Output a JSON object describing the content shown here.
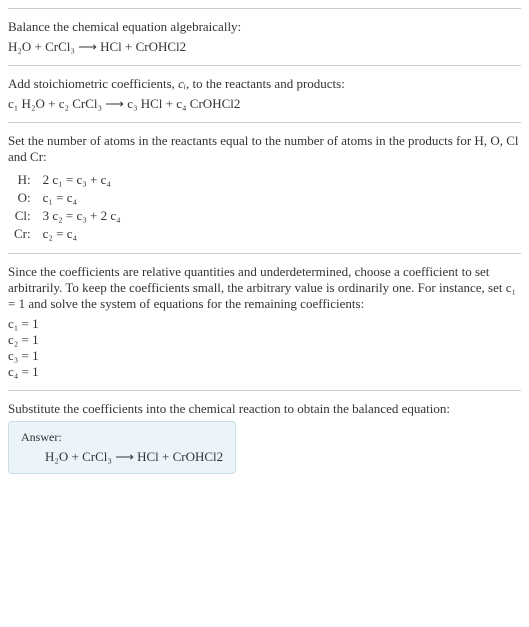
{
  "sec1": {
    "title": "Balance the chemical equation algebraically:",
    "eq": "H₂O + CrCl₃  ⟶  HCl + CrOHCl2"
  },
  "sec2": {
    "title_a": "Add stoichiometric coefficients, ",
    "title_ci": "cᵢ",
    "title_b": ", to the reactants and products:",
    "eq": "c₁ H₂O + c₂ CrCl₃  ⟶  c₃ HCl + c₄ CrOHCl2"
  },
  "sec3": {
    "title": "Set the number of atoms in the reactants equal to the number of atoms in the products for H, O, Cl and Cr:",
    "rows": [
      {
        "el": "H:",
        "eq": "2 c₁ = c₃ + c₄"
      },
      {
        "el": "O:",
        "eq": "c₁ = c₄"
      },
      {
        "el": "Cl:",
        "eq": "3 c₂ = c₃ + 2 c₄"
      },
      {
        "el": "Cr:",
        "eq": "c₂ = c₄"
      }
    ]
  },
  "sec4": {
    "title": "Since the coefficients are relative quantities and underdetermined, choose a coefficient to set arbitrarily. To keep the coefficients small, the arbitrary value is ordinarily one. For instance, set c₁ = 1 and solve the system of equations for the remaining coefficients:",
    "vals": [
      "c₁ = 1",
      "c₂ = 1",
      "c₃ = 1",
      "c₄ = 1"
    ]
  },
  "sec5": {
    "title": "Substitute the coefficients into the chemical reaction to obtain the balanced equation:",
    "answer_label": "Answer:",
    "answer_eq": "H₂O + CrCl₃  ⟶  HCl + CrOHCl2"
  }
}
